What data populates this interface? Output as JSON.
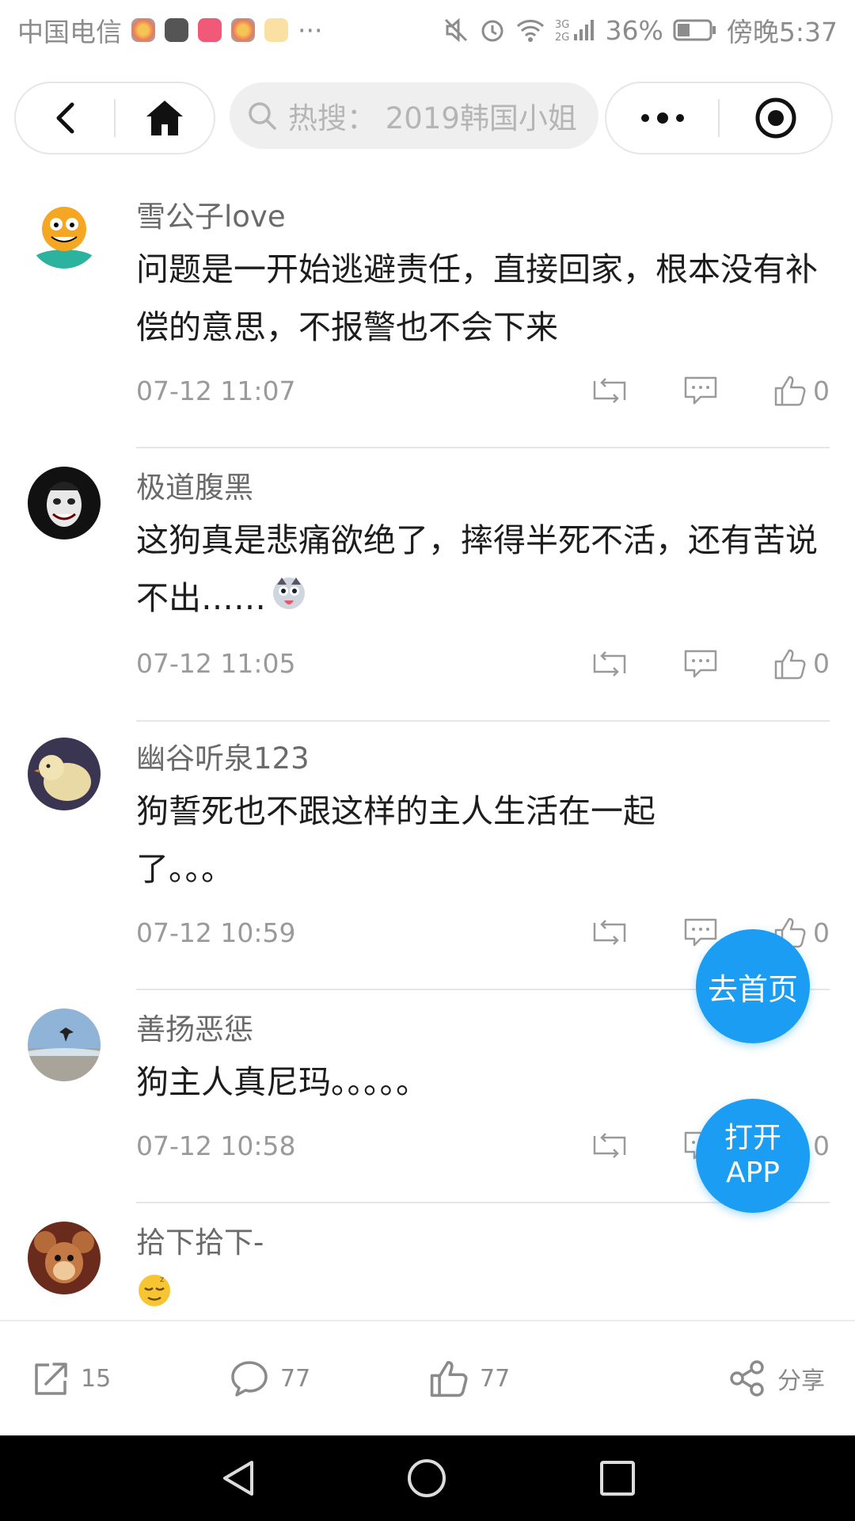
{
  "status_bar": {
    "carrier": "中国电信",
    "more": "···",
    "battery": "36%",
    "network": "3G 2G",
    "time": "傍晚5:37"
  },
  "nav": {
    "back_icon": "chevron-left-icon",
    "home_icon": "home-icon",
    "search_placeholder": "热搜： 2019韩国小姐",
    "more_icon": "more-dots-icon",
    "target_icon": "target-icon"
  },
  "comments": [
    {
      "user": "雪公子love",
      "text": "问题是一开始逃避责任，直接回家，根本没有补偿的意思，不报警也不会下来",
      "time": "07-12 11:07",
      "likes": "0",
      "avatar": "garfield-avatar"
    },
    {
      "user": "极道腹黑",
      "text": "这狗真是悲痛欲绝了，摔得半死不活，还有苦说不出……",
      "time": "07-12 11:05",
      "likes": "0",
      "avatar": "joker-avatar",
      "emoji": "husky-emoji"
    },
    {
      "user": "幽谷听泉123",
      "text": "狗誓死也不跟这样的主人生活在一起了。。。",
      "time": "07-12 10:59",
      "likes": "0",
      "avatar": "chick-avatar"
    },
    {
      "user": "善扬恶惩",
      "text": "狗主人真尼玛。。。。。",
      "time": "07-12 10:58",
      "likes": "0",
      "avatar": "beach-avatar"
    },
    {
      "user": "拾下拾下-",
      "text": "",
      "time": "",
      "likes": "",
      "avatar": "jerry-avatar",
      "emoji": "sleepy-face-emoji"
    }
  ],
  "fab": {
    "home_label": "去首页",
    "app_line1": "打开",
    "app_line2": "APP"
  },
  "toolbar": {
    "repost_count": "15",
    "comment_count": "77",
    "like_count": "77",
    "share_label": "分享"
  },
  "colors": {
    "accent": "#1a9df2",
    "text_primary": "#1d1d1d",
    "text_secondary": "#9a9a9a"
  }
}
